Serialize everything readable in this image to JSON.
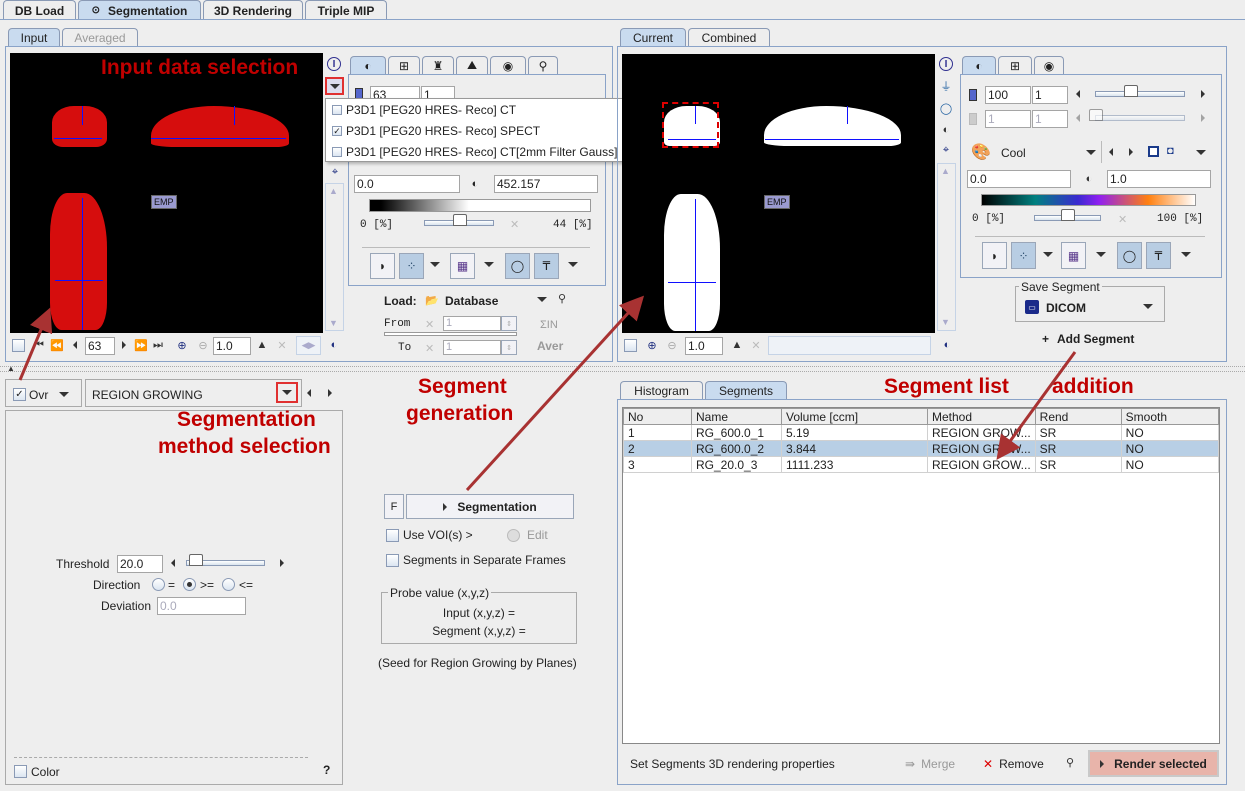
{
  "main_tabs": [
    {
      "label": "DB Load",
      "selected": false
    },
    {
      "label": "Segmentation",
      "selected": true,
      "icon": "radio-target-icon"
    },
    {
      "label": "3D Rendering",
      "selected": false
    },
    {
      "label": "Triple MIP",
      "selected": false
    }
  ],
  "input_panel": {
    "tabs": [
      {
        "label": "Input",
        "selected": true
      },
      {
        "label": "Averaged",
        "selected": false,
        "disabled": true
      }
    ],
    "viewer_label": "EMP",
    "frame_value": "63",
    "zoom_value": "1.0",
    "dropdown_options": [
      {
        "label": "P3D1 [PEG20 HRES- Reco] CT",
        "checked": false
      },
      {
        "label": "P3D1 [PEG20 HRES- Reco] SPECT",
        "checked": true
      },
      {
        "label": "P3D1 [PEG20 HRES- Reco] CT[2mm Filter Gauss]",
        "checked": false
      }
    ],
    "color_fields": {
      "slice": "63",
      "step": "1",
      "min": "0.0",
      "max": "452.157"
    },
    "range_lower": "0",
    "range_upper": "44",
    "range_unit": "[%]",
    "load_label": "Load:",
    "load_source": "Database",
    "from_label": "From",
    "to_label": "To",
    "from_value": "1",
    "to_value": "1",
    "sum_label": "ΣIN",
    "aver_label": "Aver"
  },
  "result_panel": {
    "tabs": [
      {
        "label": "Current",
        "selected": true
      },
      {
        "label": "Combined",
        "selected": false
      }
    ],
    "viewer_label": "EMP",
    "zoom_value": "1.0",
    "level_fields": {
      "a": "100",
      "b": "1",
      "c": "1",
      "d": "1"
    },
    "colormap": "Cool",
    "min": "0.0",
    "max": "1.0",
    "range_lower": "0",
    "range_upper": "100",
    "range_unit": "[%]",
    "save_segment_title": "Save Segment",
    "save_format": "DICOM",
    "add_segment_label": "Add Segment"
  },
  "method_bar": {
    "ovr_label": "Ovr",
    "ovr_checked": true,
    "method": "REGION GROWING"
  },
  "method_params": {
    "threshold_label": "Threshold",
    "threshold_value": "20.0",
    "threshold_fraction": 0.05,
    "direction_label": "Direction",
    "direction_options": [
      "=",
      ">=",
      "<="
    ],
    "direction_selected": ">=",
    "deviation_label": "Deviation",
    "deviation_value": "0.0",
    "color_label": "Color",
    "help_label": "?"
  },
  "segmentation_controls": {
    "f_label": "F",
    "segmentation_button": "Segmentation",
    "use_vois_label": "Use VOI(s) >",
    "edit_label": "Edit",
    "separate_frames_label": "Segments in Separate Frames",
    "probe_title": "Probe value (x,y,z)",
    "probe_input": "Input (x,y,z) =",
    "probe_segment": "Segment (x,y,z) =",
    "seed_note": "(Seed for Region Growing by Planes)"
  },
  "segments_panel": {
    "tabs": [
      {
        "label": "Histogram",
        "selected": false
      },
      {
        "label": "Segments",
        "selected": true
      }
    ],
    "columns": [
      "No",
      "Name",
      "Volume [ccm]",
      "Method",
      "Rend",
      "Smooth"
    ],
    "rows": [
      [
        "1",
        "RG_600.0_1",
        "5.19",
        "REGION GROW...",
        "SR",
        "NO"
      ],
      [
        "2",
        "RG_600.0_2",
        "3.844",
        "REGION GROW...",
        "SR",
        "NO"
      ],
      [
        "3",
        "RG_20.0_3",
        "1111.233",
        "REGION GROW...",
        "SR",
        "NO"
      ]
    ],
    "selected_row": 1,
    "footer_text": "Set Segments 3D rendering properties",
    "merge_label": "Merge",
    "remove_label": "Remove",
    "render_selected_label": "Render selected"
  },
  "annotations": {
    "input_selection": "Input data selection",
    "method_selection_1": "Segmentation",
    "method_selection_2": "method selection",
    "segment_generation_1": "Segment",
    "segment_generation_2": "generation",
    "segment_list": "Segment list",
    "addition": "addition"
  },
  "colors": {
    "annotation_red": "#c00000",
    "tab_selected": "#c9dbef",
    "row_selected": "#b8cfe5",
    "render_button": "#e8b4aa",
    "segment_red": "#dd1111"
  }
}
